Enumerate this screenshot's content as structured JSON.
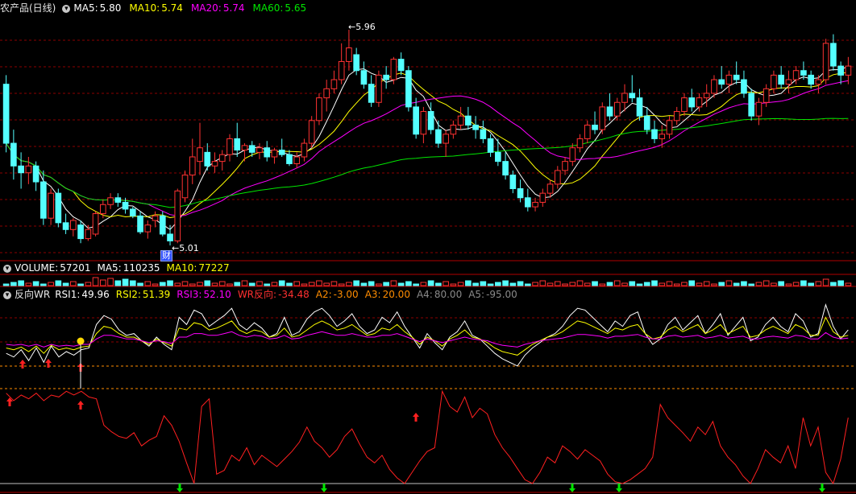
{
  "title": "农产品(日线)",
  "price_panel": {
    "ma5_label": "MA5:",
    "ma5_value": "5.80",
    "ma10_label": "MA10:",
    "ma10_value": "5.74",
    "ma20_label": "MA20:",
    "ma20_value": "5.74",
    "ma60_label": "MA60:",
    "ma60_value": "5.65",
    "high_label": "5.96",
    "low_label": "5.01",
    "finance_marker": "财"
  },
  "volume_panel": {
    "vol_label": "VOLUME:",
    "vol_value": "57201",
    "ma5_label": "MA5:",
    "ma5_value": "110235",
    "ma10_label": "MA10:",
    "ma10_value": "77227"
  },
  "indicator_panel": {
    "name": "反向WR",
    "rsi1_label": "RSI1:",
    "rsi1_value": "49.96",
    "rsi2_label": "RSI2:",
    "rsi2_value": "51.39",
    "rsi3_label": "RSI3:",
    "rsi3_value": "52.10",
    "wr_label": "WR反向:",
    "wr_value": "-34.48",
    "a2_label": "A2:",
    "a2_value": "-3.00",
    "a3_label": "A3:",
    "a3_value": "20.00",
    "a4_label": "A4:",
    "a4_value": "80.00",
    "a5_label": "A5:",
    "a5_value": "-95.00"
  },
  "colors": {
    "up": "#ff3232",
    "down": "#54ffff",
    "ma5": "#ffffff",
    "ma10": "#ffff00",
    "ma20": "#ff00ff",
    "ma60": "#00e600",
    "grid": "#8b0000",
    "wr": "#ff2020"
  },
  "chart_data": [
    {
      "type": "candlestick",
      "ylim": [
        4.95,
        6.02
      ],
      "ohlc": [
        [
          5.72,
          5.76,
          5.42,
          5.46
        ],
        [
          5.46,
          5.52,
          5.3,
          5.36
        ],
        [
          5.36,
          5.42,
          5.26,
          5.33
        ],
        [
          5.33,
          5.4,
          5.28,
          5.36
        ],
        [
          5.36,
          5.38,
          5.25,
          5.29
        ],
        [
          5.29,
          5.34,
          5.1,
          5.13
        ],
        [
          5.13,
          5.26,
          5.1,
          5.24
        ],
        [
          5.24,
          5.26,
          5.09,
          5.11
        ],
        [
          5.11,
          5.15,
          5.06,
          5.08
        ],
        [
          5.08,
          5.13,
          5.05,
          5.12
        ],
        [
          5.1,
          5.12,
          5.02,
          5.04
        ],
        [
          5.04,
          5.1,
          5.03,
          5.08
        ],
        [
          5.06,
          5.16,
          5.05,
          5.15
        ],
        [
          5.15,
          5.21,
          5.13,
          5.19
        ],
        [
          5.19,
          5.24,
          5.17,
          5.22
        ],
        [
          5.22,
          5.24,
          5.18,
          5.2
        ],
        [
          5.2,
          5.22,
          5.15,
          5.17
        ],
        [
          5.17,
          5.18,
          5.13,
          5.14
        ],
        [
          5.14,
          5.16,
          5.06,
          5.07
        ],
        [
          5.07,
          5.12,
          5.04,
          5.1
        ],
        [
          5.12,
          5.16,
          5.09,
          5.14
        ],
        [
          5.14,
          5.16,
          5.05,
          5.06
        ],
        [
          5.06,
          5.1,
          5.01,
          5.03
        ],
        [
          5.03,
          5.26,
          5.02,
          5.25
        ],
        [
          5.22,
          5.34,
          5.2,
          5.32
        ],
        [
          5.32,
          5.48,
          5.28,
          5.4
        ],
        [
          5.38,
          5.55,
          5.32,
          5.44
        ],
        [
          5.42,
          5.46,
          5.34,
          5.36
        ],
        [
          5.36,
          5.42,
          5.33,
          5.38
        ],
        [
          5.38,
          5.43,
          5.34,
          5.41
        ],
        [
          5.41,
          5.5,
          5.38,
          5.48
        ],
        [
          5.48,
          5.55,
          5.4,
          5.43
        ],
        [
          5.43,
          5.46,
          5.38,
          5.45
        ],
        [
          5.45,
          5.47,
          5.4,
          5.42
        ],
        [
          5.42,
          5.46,
          5.39,
          5.44
        ],
        [
          5.44,
          5.47,
          5.38,
          5.4
        ],
        [
          5.4,
          5.44,
          5.37,
          5.43
        ],
        [
          5.43,
          5.48,
          5.4,
          5.41
        ],
        [
          5.41,
          5.43,
          5.36,
          5.37
        ],
        [
          5.37,
          5.42,
          5.35,
          5.4
        ],
        [
          5.4,
          5.48,
          5.38,
          5.46
        ],
        [
          5.46,
          5.58,
          5.44,
          5.56
        ],
        [
          5.56,
          5.68,
          5.54,
          5.66
        ],
        [
          5.66,
          5.74,
          5.6,
          5.7
        ],
        [
          5.7,
          5.78,
          5.68,
          5.74
        ],
        [
          5.74,
          5.9,
          5.72,
          5.82
        ],
        [
          5.82,
          5.96,
          5.78,
          5.88
        ],
        [
          5.85,
          5.88,
          5.76,
          5.78
        ],
        [
          5.78,
          5.82,
          5.7,
          5.72
        ],
        [
          5.72,
          5.76,
          5.62,
          5.64
        ],
        [
          5.64,
          5.78,
          5.62,
          5.76
        ],
        [
          5.76,
          5.8,
          5.7,
          5.74
        ],
        [
          5.74,
          5.84,
          5.72,
          5.83
        ],
        [
          5.83,
          5.86,
          5.76,
          5.78
        ],
        [
          5.78,
          5.8,
          5.6,
          5.62
        ],
        [
          5.62,
          5.66,
          5.48,
          5.5
        ],
        [
          5.5,
          5.62,
          5.46,
          5.6
        ],
        [
          5.6,
          5.64,
          5.5,
          5.52
        ],
        [
          5.52,
          5.56,
          5.44,
          5.46
        ],
        [
          5.46,
          5.52,
          5.4,
          5.5
        ],
        [
          5.5,
          5.56,
          5.48,
          5.54
        ],
        [
          5.54,
          5.62,
          5.52,
          5.58
        ],
        [
          5.58,
          5.62,
          5.52,
          5.54
        ],
        [
          5.54,
          5.58,
          5.48,
          5.52
        ],
        [
          5.52,
          5.56,
          5.46,
          5.48
        ],
        [
          5.48,
          5.5,
          5.4,
          5.42
        ],
        [
          5.42,
          5.48,
          5.36,
          5.38
        ],
        [
          5.38,
          5.42,
          5.3,
          5.32
        ],
        [
          5.32,
          5.34,
          5.24,
          5.26
        ],
        [
          5.26,
          5.3,
          5.2,
          5.22
        ],
        [
          5.22,
          5.26,
          5.16,
          5.18
        ],
        [
          5.18,
          5.22,
          5.16,
          5.2
        ],
        [
          5.2,
          5.26,
          5.18,
          5.24
        ],
        [
          5.24,
          5.3,
          5.22,
          5.28
        ],
        [
          5.28,
          5.36,
          5.26,
          5.34
        ],
        [
          5.34,
          5.4,
          5.32,
          5.38
        ],
        [
          5.38,
          5.46,
          5.36,
          5.44
        ],
        [
          5.44,
          5.5,
          5.42,
          5.48
        ],
        [
          5.48,
          5.56,
          5.46,
          5.54
        ],
        [
          5.54,
          5.6,
          5.5,
          5.52
        ],
        [
          5.52,
          5.64,
          5.5,
          5.62
        ],
        [
          5.62,
          5.68,
          5.56,
          5.58
        ],
        [
          5.58,
          5.66,
          5.56,
          5.64
        ],
        [
          5.64,
          5.72,
          5.6,
          5.68
        ],
        [
          5.68,
          5.76,
          5.64,
          5.66
        ],
        [
          5.66,
          5.7,
          5.56,
          5.58
        ],
        [
          5.58,
          5.62,
          5.5,
          5.52
        ],
        [
          5.52,
          5.56,
          5.46,
          5.48
        ],
        [
          5.48,
          5.54,
          5.44,
          5.5
        ],
        [
          5.5,
          5.58,
          5.48,
          5.56
        ],
        [
          5.56,
          5.62,
          5.54,
          5.6
        ],
        [
          5.6,
          5.68,
          5.58,
          5.66
        ],
        [
          5.66,
          5.7,
          5.6,
          5.62
        ],
        [
          5.62,
          5.68,
          5.6,
          5.66
        ],
        [
          5.66,
          5.72,
          5.62,
          5.68
        ],
        [
          5.68,
          5.76,
          5.66,
          5.74
        ],
        [
          5.74,
          5.8,
          5.7,
          5.72
        ],
        [
          5.72,
          5.78,
          5.68,
          5.76
        ],
        [
          5.76,
          5.82,
          5.72,
          5.74
        ],
        [
          5.74,
          5.78,
          5.66,
          5.68
        ],
        [
          5.68,
          5.7,
          5.56,
          5.58
        ],
        [
          5.58,
          5.66,
          5.54,
          5.64
        ],
        [
          5.64,
          5.72,
          5.62,
          5.7
        ],
        [
          5.7,
          5.78,
          5.68,
          5.76
        ],
        [
          5.76,
          5.8,
          5.7,
          5.72
        ],
        [
          5.72,
          5.78,
          5.68,
          5.74
        ],
        [
          5.74,
          5.8,
          5.72,
          5.78
        ],
        [
          5.78,
          5.82,
          5.74,
          5.76
        ],
        [
          5.76,
          5.78,
          5.7,
          5.72
        ],
        [
          5.72,
          5.76,
          5.68,
          5.74
        ],
        [
          5.74,
          5.92,
          5.72,
          5.9
        ],
        [
          5.9,
          5.94,
          5.78,
          5.8
        ],
        [
          5.8,
          5.82,
          5.72,
          5.76
        ],
        [
          5.76,
          5.84,
          5.72,
          5.8
        ]
      ]
    },
    {
      "type": "line",
      "name": "RSI panel",
      "ylim": [
        0,
        100
      ],
      "series": [
        {
          "name": "RSI1",
          "values": [
            40,
            36,
            44,
            32,
            46,
            30,
            48,
            36,
            42,
            38,
            44,
            46,
            72,
            82,
            78,
            66,
            60,
            62,
            54,
            48,
            58,
            50,
            44,
            80,
            72,
            88,
            84,
            70,
            76,
            82,
            90,
            72,
            66,
            74,
            68,
            58,
            62,
            80,
            60,
            64,
            78,
            86,
            90,
            82,
            70,
            76,
            84,
            70,
            62,
            66,
            80,
            74,
            86,
            70,
            58,
            46,
            62,
            52,
            44,
            58,
            64,
            76,
            60,
            56,
            48,
            40,
            34,
            30,
            26,
            38,
            46,
            52,
            58,
            62,
            70,
            82,
            90,
            88,
            80,
            72,
            64,
            76,
            70,
            82,
            86,
            62,
            50,
            56,
            72,
            80,
            66,
            74,
            82,
            62,
            72,
            84,
            60,
            70,
            80,
            54,
            58,
            72,
            80,
            70,
            64,
            84,
            76,
            58,
            62,
            94,
            70,
            56,
            66
          ]
        },
        {
          "name": "RSI2",
          "values": [
            46,
            44,
            47,
            42,
            48,
            40,
            49,
            44,
            46,
            44,
            47,
            48,
            62,
            70,
            68,
            62,
            58,
            58,
            54,
            50,
            56,
            52,
            48,
            68,
            66,
            74,
            72,
            66,
            68,
            72,
            76,
            66,
            62,
            66,
            64,
            58,
            60,
            68,
            58,
            60,
            66,
            72,
            76,
            72,
            66,
            68,
            72,
            66,
            60,
            62,
            68,
            66,
            72,
            64,
            58,
            50,
            58,
            54,
            48,
            56,
            60,
            66,
            58,
            56,
            52,
            46,
            42,
            40,
            38,
            44,
            50,
            54,
            58,
            60,
            64,
            70,
            76,
            74,
            70,
            66,
            62,
            68,
            66,
            70,
            72,
            62,
            56,
            58,
            66,
            70,
            64,
            68,
            72,
            62,
            66,
            72,
            62,
            66,
            70,
            58,
            60,
            66,
            70,
            66,
            62,
            72,
            68,
            60,
            60,
            80,
            64,
            58,
            60
          ]
        },
        {
          "name": "RSI3",
          "values": [
            50,
            49,
            50,
            48,
            50,
            47,
            50,
            48,
            49,
            48,
            50,
            50,
            56,
            60,
            60,
            58,
            56,
            56,
            54,
            52,
            54,
            53,
            51,
            58,
            58,
            62,
            62,
            60,
            60,
            62,
            64,
            60,
            58,
            60,
            59,
            56,
            57,
            60,
            56,
            57,
            60,
            62,
            64,
            62,
            60,
            60,
            62,
            60,
            58,
            58,
            60,
            60,
            62,
            59,
            56,
            53,
            56,
            54,
            52,
            54,
            56,
            58,
            56,
            55,
            54,
            51,
            49,
            48,
            47,
            50,
            52,
            54,
            55,
            56,
            57,
            59,
            61,
            61,
            60,
            59,
            57,
            59,
            59,
            60,
            61,
            58,
            56,
            56,
            59,
            60,
            58,
            59,
            60,
            57,
            58,
            60,
            57,
            58,
            59,
            56,
            56,
            58,
            59,
            58,
            57,
            60,
            59,
            56,
            56,
            63,
            58,
            56,
            57
          ]
        }
      ]
    },
    {
      "type": "line",
      "name": "WR panel",
      "ylim": [
        -100,
        0
      ],
      "series": [
        {
          "name": "WR反向",
          "values": [
            -4,
            -12,
            -6,
            -10,
            -4,
            -12,
            -6,
            -8,
            -2,
            -6,
            -2,
            -8,
            -10,
            -38,
            -45,
            -50,
            -52,
            -46,
            -60,
            -54,
            -50,
            -28,
            -38,
            -55,
            -78,
            -100,
            -18,
            -10,
            -90,
            -86,
            -70,
            -76,
            -62,
            -80,
            -70,
            -76,
            -82,
            -74,
            -66,
            -56,
            -40,
            -55,
            -62,
            -72,
            -64,
            -50,
            -42,
            -58,
            -72,
            -78,
            -70,
            -85,
            -94,
            -100,
            -88,
            -76,
            -66,
            -62,
            -2,
            -18,
            -24,
            -8,
            -30,
            -20,
            -26,
            -48,
            -62,
            -72,
            -84,
            -96,
            -100,
            -88,
            -72,
            -78,
            -60,
            -66,
            -74,
            -64,
            -70,
            -76,
            -90,
            -98,
            -100,
            -96,
            -90,
            -84,
            -72,
            -16,
            -30,
            -38,
            -46,
            -55,
            -40,
            -48,
            -34,
            -60,
            -72,
            -80,
            -92,
            -100,
            -84,
            -64,
            -72,
            -78,
            -60,
            -84,
            -30,
            -60,
            -40,
            -88,
            -100,
            -74,
            -30
          ]
        }
      ]
    }
  ]
}
